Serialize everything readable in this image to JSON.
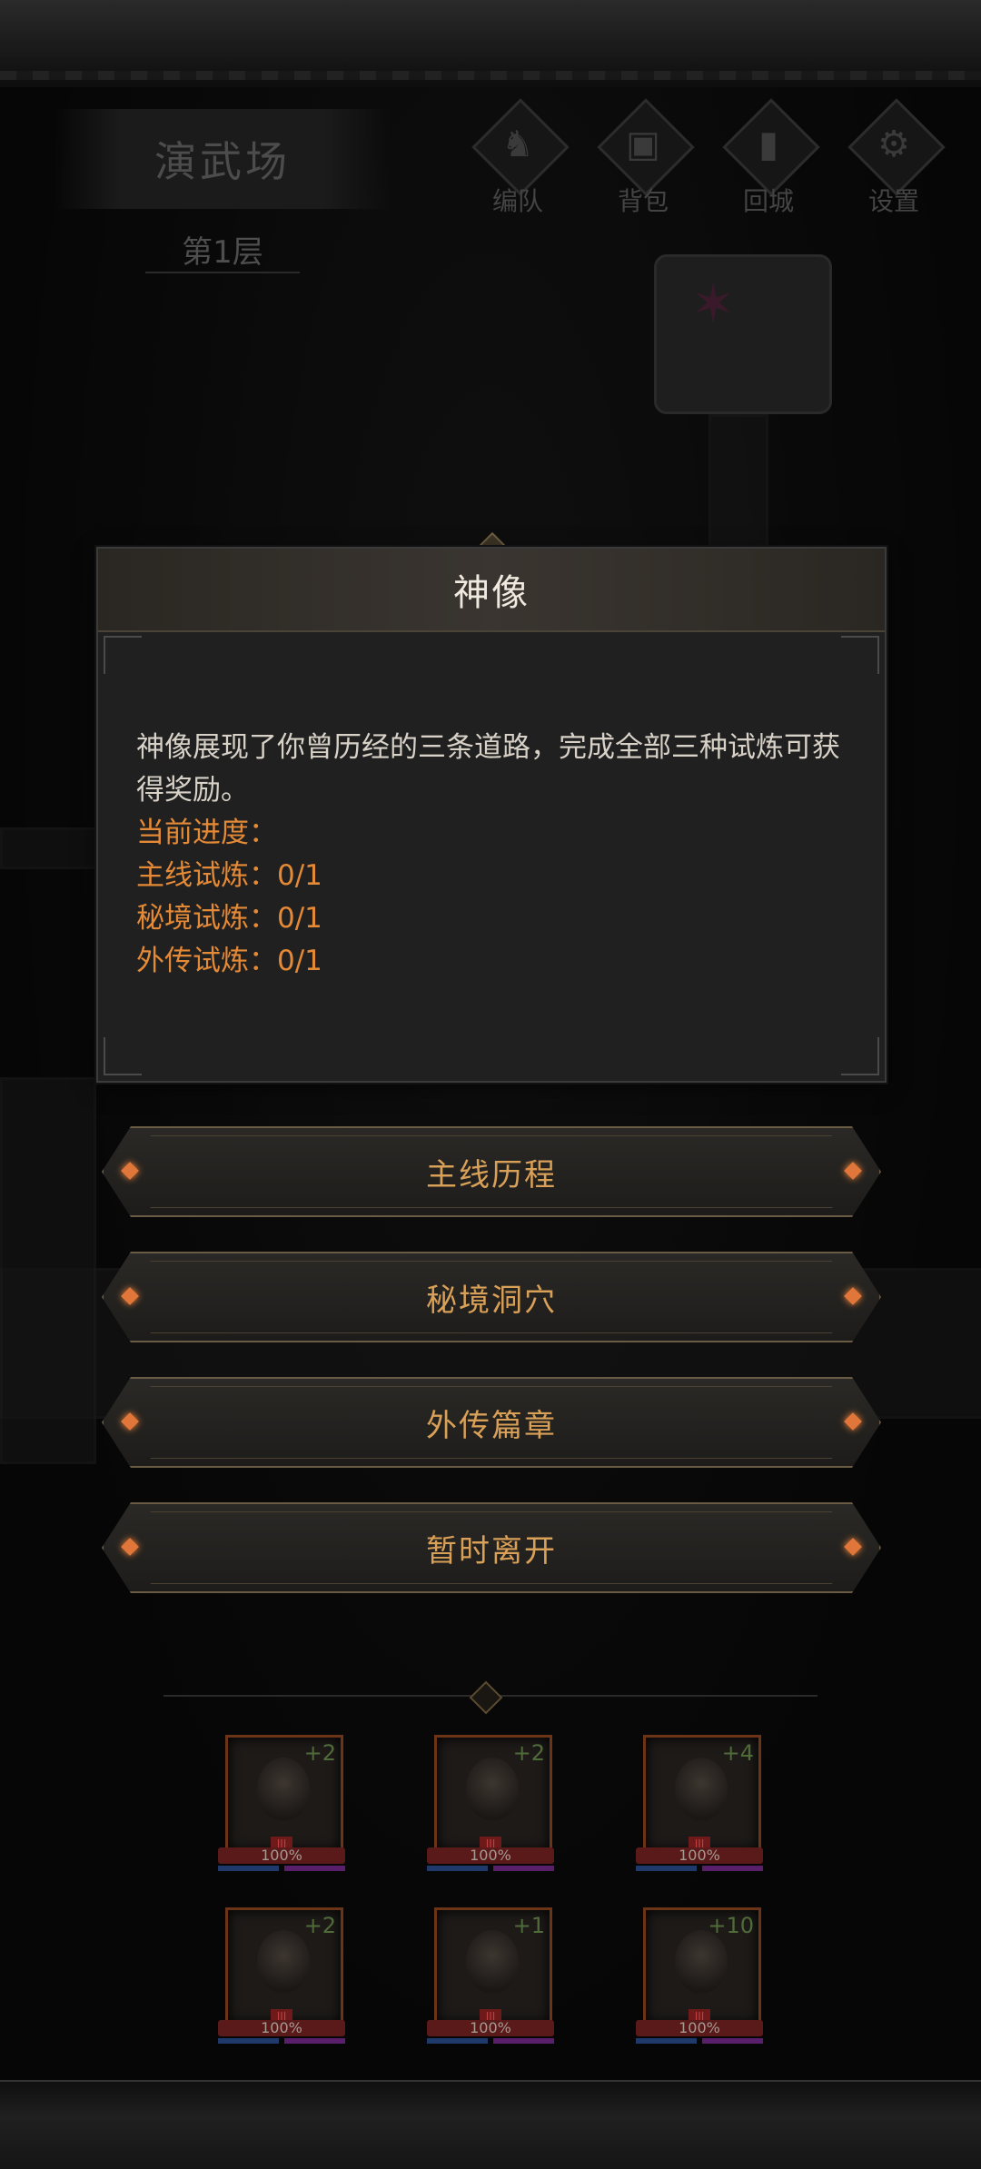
{
  "scene": {
    "location_title": "演武场",
    "floor": "第1层",
    "nav": [
      {
        "label": "编队",
        "icon": "helmet-icon"
      },
      {
        "label": "背包",
        "icon": "backpack-icon"
      },
      {
        "label": "回城",
        "icon": "door-icon"
      },
      {
        "label": "设置",
        "icon": "gear-icon"
      }
    ]
  },
  "dialog": {
    "title": "神像",
    "description": "神像展现了你曾历经的三条道路，完成全部三种试炼可获得奖励。",
    "progress_label": "当前进度：",
    "progress": [
      {
        "text": "主线试炼：0/1"
      },
      {
        "text": "秘境试炼：0/1"
      },
      {
        "text": "外传试炼：0/1"
      }
    ]
  },
  "options": [
    {
      "label": "主线历程"
    },
    {
      "label": "秘境洞穴"
    },
    {
      "label": "外传篇章"
    },
    {
      "label": "暂时离开"
    }
  ],
  "party": [
    {
      "bonus": "+2",
      "hp": "100%"
    },
    {
      "bonus": "+2",
      "hp": "100%"
    },
    {
      "bonus": "+4",
      "hp": "100%"
    },
    {
      "bonus": "+2",
      "hp": "100%"
    },
    {
      "bonus": "+1",
      "hp": "100%"
    },
    {
      "bonus": "+10",
      "hp": "100%"
    }
  ],
  "colors": {
    "accent_orange": "#e48a37",
    "button_text": "#d9a057",
    "dialog_bg": "#202020"
  }
}
